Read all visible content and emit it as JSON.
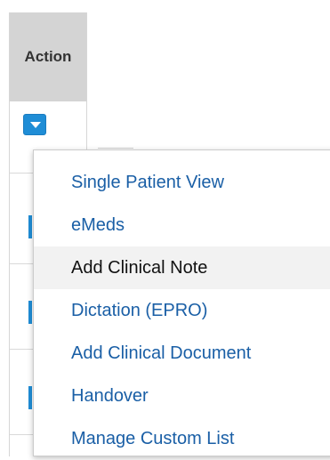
{
  "table": {
    "column_header": "Action"
  },
  "action_menu": {
    "items": [
      {
        "label": "Single Patient View"
      },
      {
        "label": "eMeds"
      },
      {
        "label": "Add Clinical Note"
      },
      {
        "label": "Dictation (EPRO)"
      },
      {
        "label": "Add Clinical Document"
      },
      {
        "label": "Handover"
      },
      {
        "label": "Manage Custom List"
      }
    ],
    "highlighted_item": "Add Clinical Note"
  },
  "colors": {
    "accent": "#1f8dd6",
    "link": "#1a5fa6",
    "header_bg": "#d4d4d4"
  }
}
